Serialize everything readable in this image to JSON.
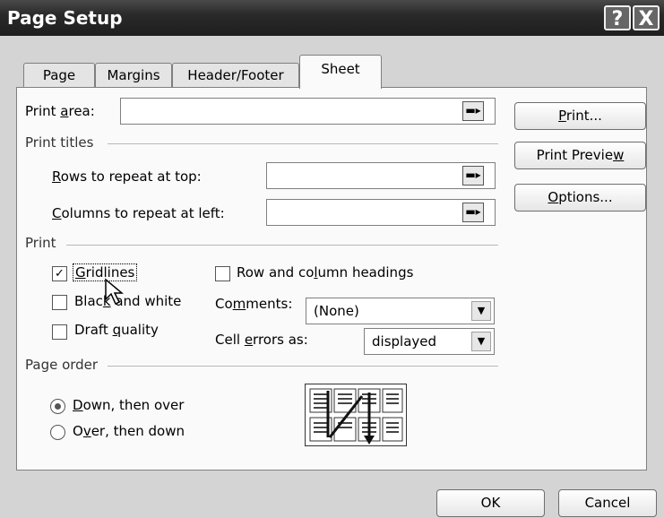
{
  "window": {
    "title": "Page Setup",
    "help_btn": "?",
    "close_btn": "X"
  },
  "tabs": [
    "Page",
    "Margins",
    "Header/Footer",
    "Sheet"
  ],
  "print_area": {
    "label_pre": "Print ",
    "label_u": "a",
    "label_post": "rea:",
    "value": ""
  },
  "print_titles": {
    "header": "Print titles",
    "rows": {
      "label_u": "R",
      "label_post": "ows to repeat at top:",
      "value": ""
    },
    "columns": {
      "label_u": "C",
      "label_post": "olumns to repeat at left:",
      "value": ""
    }
  },
  "print": {
    "header": "Print",
    "gridlines": {
      "pre": "",
      "u": "G",
      "post": "ridlines",
      "checked": true
    },
    "black_white": {
      "pre": "Blac",
      "u": "k",
      "post": " and white",
      "checked": false
    },
    "draft": {
      "pre": "Draft ",
      "u": "q",
      "post": "uality",
      "checked": false
    },
    "row_col_headings": {
      "pre": "Row and co",
      "u": "l",
      "post": "umn headings",
      "checked": false
    },
    "comments": {
      "pre": "Co",
      "u": "m",
      "post": "ments:",
      "value": "(None)"
    },
    "cell_errors": {
      "pre": "Cell ",
      "u": "e",
      "post": "rrors as:",
      "value": "displayed"
    }
  },
  "page_order": {
    "header": "Page order",
    "down_over": {
      "u": "D",
      "post": "own, then over",
      "selected": true
    },
    "over_down": {
      "pre": "O",
      "u": "v",
      "post": "er, then down",
      "selected": false
    }
  },
  "side_buttons": {
    "print": {
      "u": "P",
      "post": "rint..."
    },
    "preview": {
      "pre": "Print Previe",
      "u": "w",
      "post": ""
    },
    "options": {
      "u": "O",
      "post": "ptions..."
    }
  },
  "footer": {
    "ok": "OK",
    "cancel": "Cancel"
  },
  "icons": {
    "collapse": "collapse-dialog-icon",
    "dropdown": "chevron-down-icon"
  }
}
